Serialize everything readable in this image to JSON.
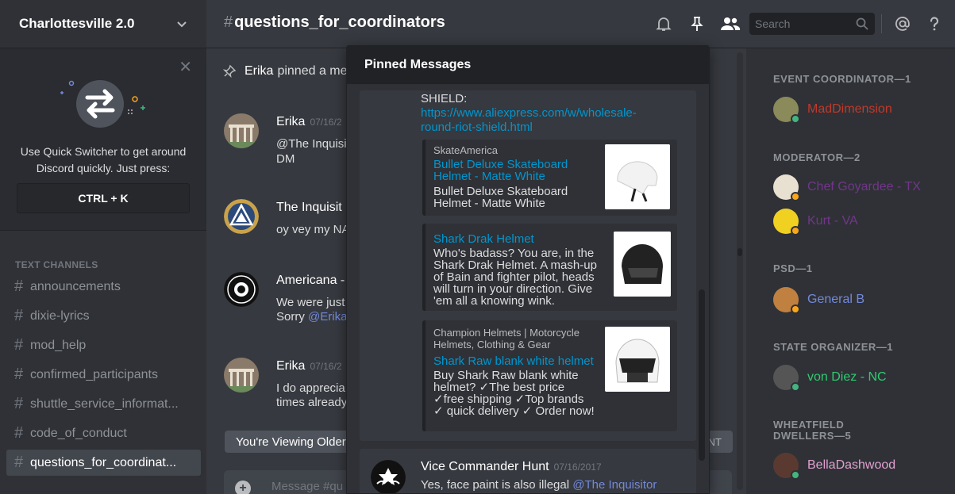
{
  "server": {
    "name": "Charlottesville 2.0"
  },
  "quick_switcher": {
    "text_line1": "Use Quick Switcher to get around",
    "text_line2": "Discord quickly. Just press:",
    "shortcut": "CTRL + K"
  },
  "sidebar": {
    "category": "TEXT CHANNELS",
    "channels": [
      {
        "name": "announcements"
      },
      {
        "name": "dixie-lyrics"
      },
      {
        "name": "mod_help"
      },
      {
        "name": "confirmed_participants"
      },
      {
        "name": "shuttle_service_informat..."
      },
      {
        "name": "code_of_conduct"
      },
      {
        "name": "questions_for_coordinat...",
        "active": true
      }
    ]
  },
  "header": {
    "hash": "#",
    "channel": "questions_for_coordinators",
    "search_placeholder": "Search"
  },
  "chat": {
    "pin_notice_user": "Erika",
    "pin_notice_text": "pinned a me",
    "messages": [
      {
        "author": "Erika",
        "time": "07/16/2",
        "line1": "@The Inquisit",
        "line2": "DM"
      },
      {
        "author": "The Inquisit",
        "time": "",
        "line1": "oy vey my NA",
        "line2": ""
      },
      {
        "author": "Americana -",
        "time": "",
        "line1": "We were just",
        "line2_pre": "Sorry ",
        "line2_mention": "@Erika"
      },
      {
        "author": "Erika",
        "time": "07/16/2",
        "line1": "I do apprecia",
        "line2": "times already"
      }
    ],
    "older_notice": "You're Viewing Older",
    "older_jump": "NT",
    "composer_placeholder": "Message #qu"
  },
  "pinned": {
    "title": "Pinned Messages",
    "message_text": "SHIELD:",
    "message_link_line1": "https://www.aliexpress.com/w/wholesale-",
    "message_link_line2": "round-riot-shield.html",
    "embeds": [
      {
        "provider": "SkateAmerica",
        "title_line1": "Bullet Deluxe Skateboard",
        "title_line2": "Helmet - Matte White",
        "desc_lines": [
          "Bullet Deluxe Skateboard",
          "Helmet - Matte White"
        ]
      },
      {
        "provider": "",
        "title_line1": "Shark Drak Helmet",
        "title_line2": "",
        "desc_lines": [
          "Who's badass? You are, in the",
          "Shark Drak Helmet. A mash-up",
          "of Bain and fighter pilot, heads",
          "will turn in your direction. Give",
          "'em all a knowing wink."
        ]
      },
      {
        "provider_lines": [
          "Champion Helmets | Motorcycle",
          "Helmets, Clothing & Gear"
        ],
        "title_line1": "Shark Raw blank white helmet",
        "title_line2": "",
        "desc_lines": [
          "Buy Shark Raw blank white",
          "helmet? ✓The best price",
          "✓free shipping ✓Top brands",
          "✓ quick delivery ✓ Order now!"
        ]
      }
    ],
    "next_message": {
      "author": "Vice Commander Hunt",
      "time": "07/16/2017",
      "text": "Yes, face paint is also illegal ",
      "mention": "@The Inquisitor"
    }
  },
  "members": {
    "groups": [
      {
        "role": "EVENT COORDINATOR—1",
        "members": [
          {
            "name": "MadDimension",
            "color": "#c0392b",
            "status": "#43b581"
          }
        ]
      },
      {
        "role": "MODERATOR—2",
        "members": [
          {
            "name": "Chef Goyardee - TX",
            "color": "#71368a",
            "status": "#faa61a"
          },
          {
            "name": "Kurt - VA",
            "color": "#71368a",
            "status": "#faa61a"
          }
        ]
      },
      {
        "role": "PSD—1",
        "members": [
          {
            "name": "General B",
            "color": "#7289da",
            "status": "#faa61a"
          }
        ]
      },
      {
        "role": "STATE ORGANIZER—1",
        "members": [
          {
            "name": "von Diez - NC",
            "color": "#2ecc71",
            "status": "#43b581"
          }
        ]
      },
      {
        "role_line1": "WHEATFIELD",
        "role_line2": "DWELLERS—5",
        "members": [
          {
            "name": "BellaDashwood",
            "color": "#e0a0d0",
            "status": "#43b581"
          }
        ]
      }
    ]
  }
}
